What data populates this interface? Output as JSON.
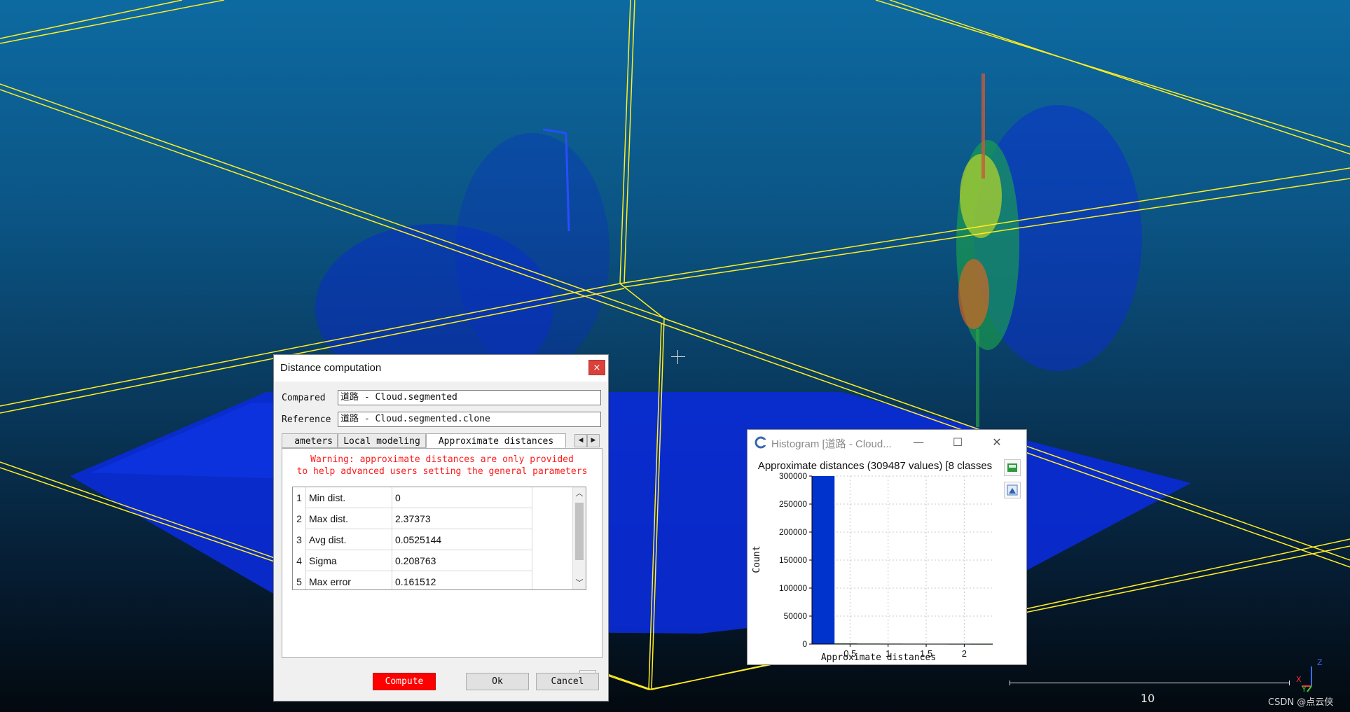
{
  "dialog": {
    "title": "Distance computation",
    "close_label": "×",
    "compared_label": "Compared",
    "compared_value": "道路 - Cloud.segmented",
    "reference_label": "Reference",
    "reference_value": "道路 - Cloud.segmented.clone",
    "tabs": [
      "ameters",
      "Local modeling",
      "Approximate distances"
    ],
    "warning_line1": "Warning: approximate distances are only provided",
    "warning_line2": "to help advanced users setting the general parameters",
    "table": [
      {
        "no": "1",
        "name": "Min dist.",
        "value": "0"
      },
      {
        "no": "2",
        "name": "Max dist.",
        "value": "2.37373"
      },
      {
        "no": "3",
        "name": "Avg dist.",
        "value": "0.0525144"
      },
      {
        "no": "4",
        "name": "Sigma",
        "value": "0.208763"
      },
      {
        "no": "5",
        "name": "Max error",
        "value": "0.161512"
      }
    ],
    "buttons": {
      "compute": "Compute",
      "ok": "Ok",
      "cancel": "Cancel"
    }
  },
  "histogram_window": {
    "title": "Histogram [道路 - Cloud...",
    "minimize_label": "—",
    "maximize_label": "☐",
    "close_label": "✕"
  },
  "viewport": {
    "scale_label": "10",
    "watermark": "CSDN @点云侠",
    "axes": {
      "x": "X",
      "y": "Y",
      "z": "Z"
    }
  },
  "chart_data": {
    "type": "bar",
    "title": "Approximate distances (309487 values) [8 classes",
    "xlabel": "Approximate distances",
    "ylabel": "Count",
    "xlim": [
      0,
      2.37373
    ],
    "ylim": [
      0,
      300000
    ],
    "xticks": [
      "0.5",
      "1",
      "1.5",
      "2"
    ],
    "xtick_values": [
      0.5,
      1.0,
      1.5,
      2.0
    ],
    "yticks": [
      "0",
      "50000",
      "100000",
      "150000",
      "200000",
      "250000",
      "300000"
    ],
    "ytick_values": [
      0,
      50000,
      100000,
      150000,
      200000,
      250000,
      300000
    ],
    "bins": [
      {
        "from": 0.0,
        "to": 0.2967,
        "count": 300000
      },
      {
        "from": 0.2967,
        "to": 0.5934,
        "count": 1200
      },
      {
        "from": 0.5934,
        "to": 0.8901,
        "count": 900
      },
      {
        "from": 0.8901,
        "to": 1.1869,
        "count": 800
      },
      {
        "from": 1.1869,
        "to": 1.4836,
        "count": 700
      },
      {
        "from": 1.4836,
        "to": 1.7803,
        "count": 600
      },
      {
        "from": 1.7803,
        "to": 2.077,
        "count": 500
      },
      {
        "from": 2.077,
        "to": 2.3737,
        "count": 400
      }
    ],
    "bar_color": "#0033cc",
    "grid": true
  }
}
